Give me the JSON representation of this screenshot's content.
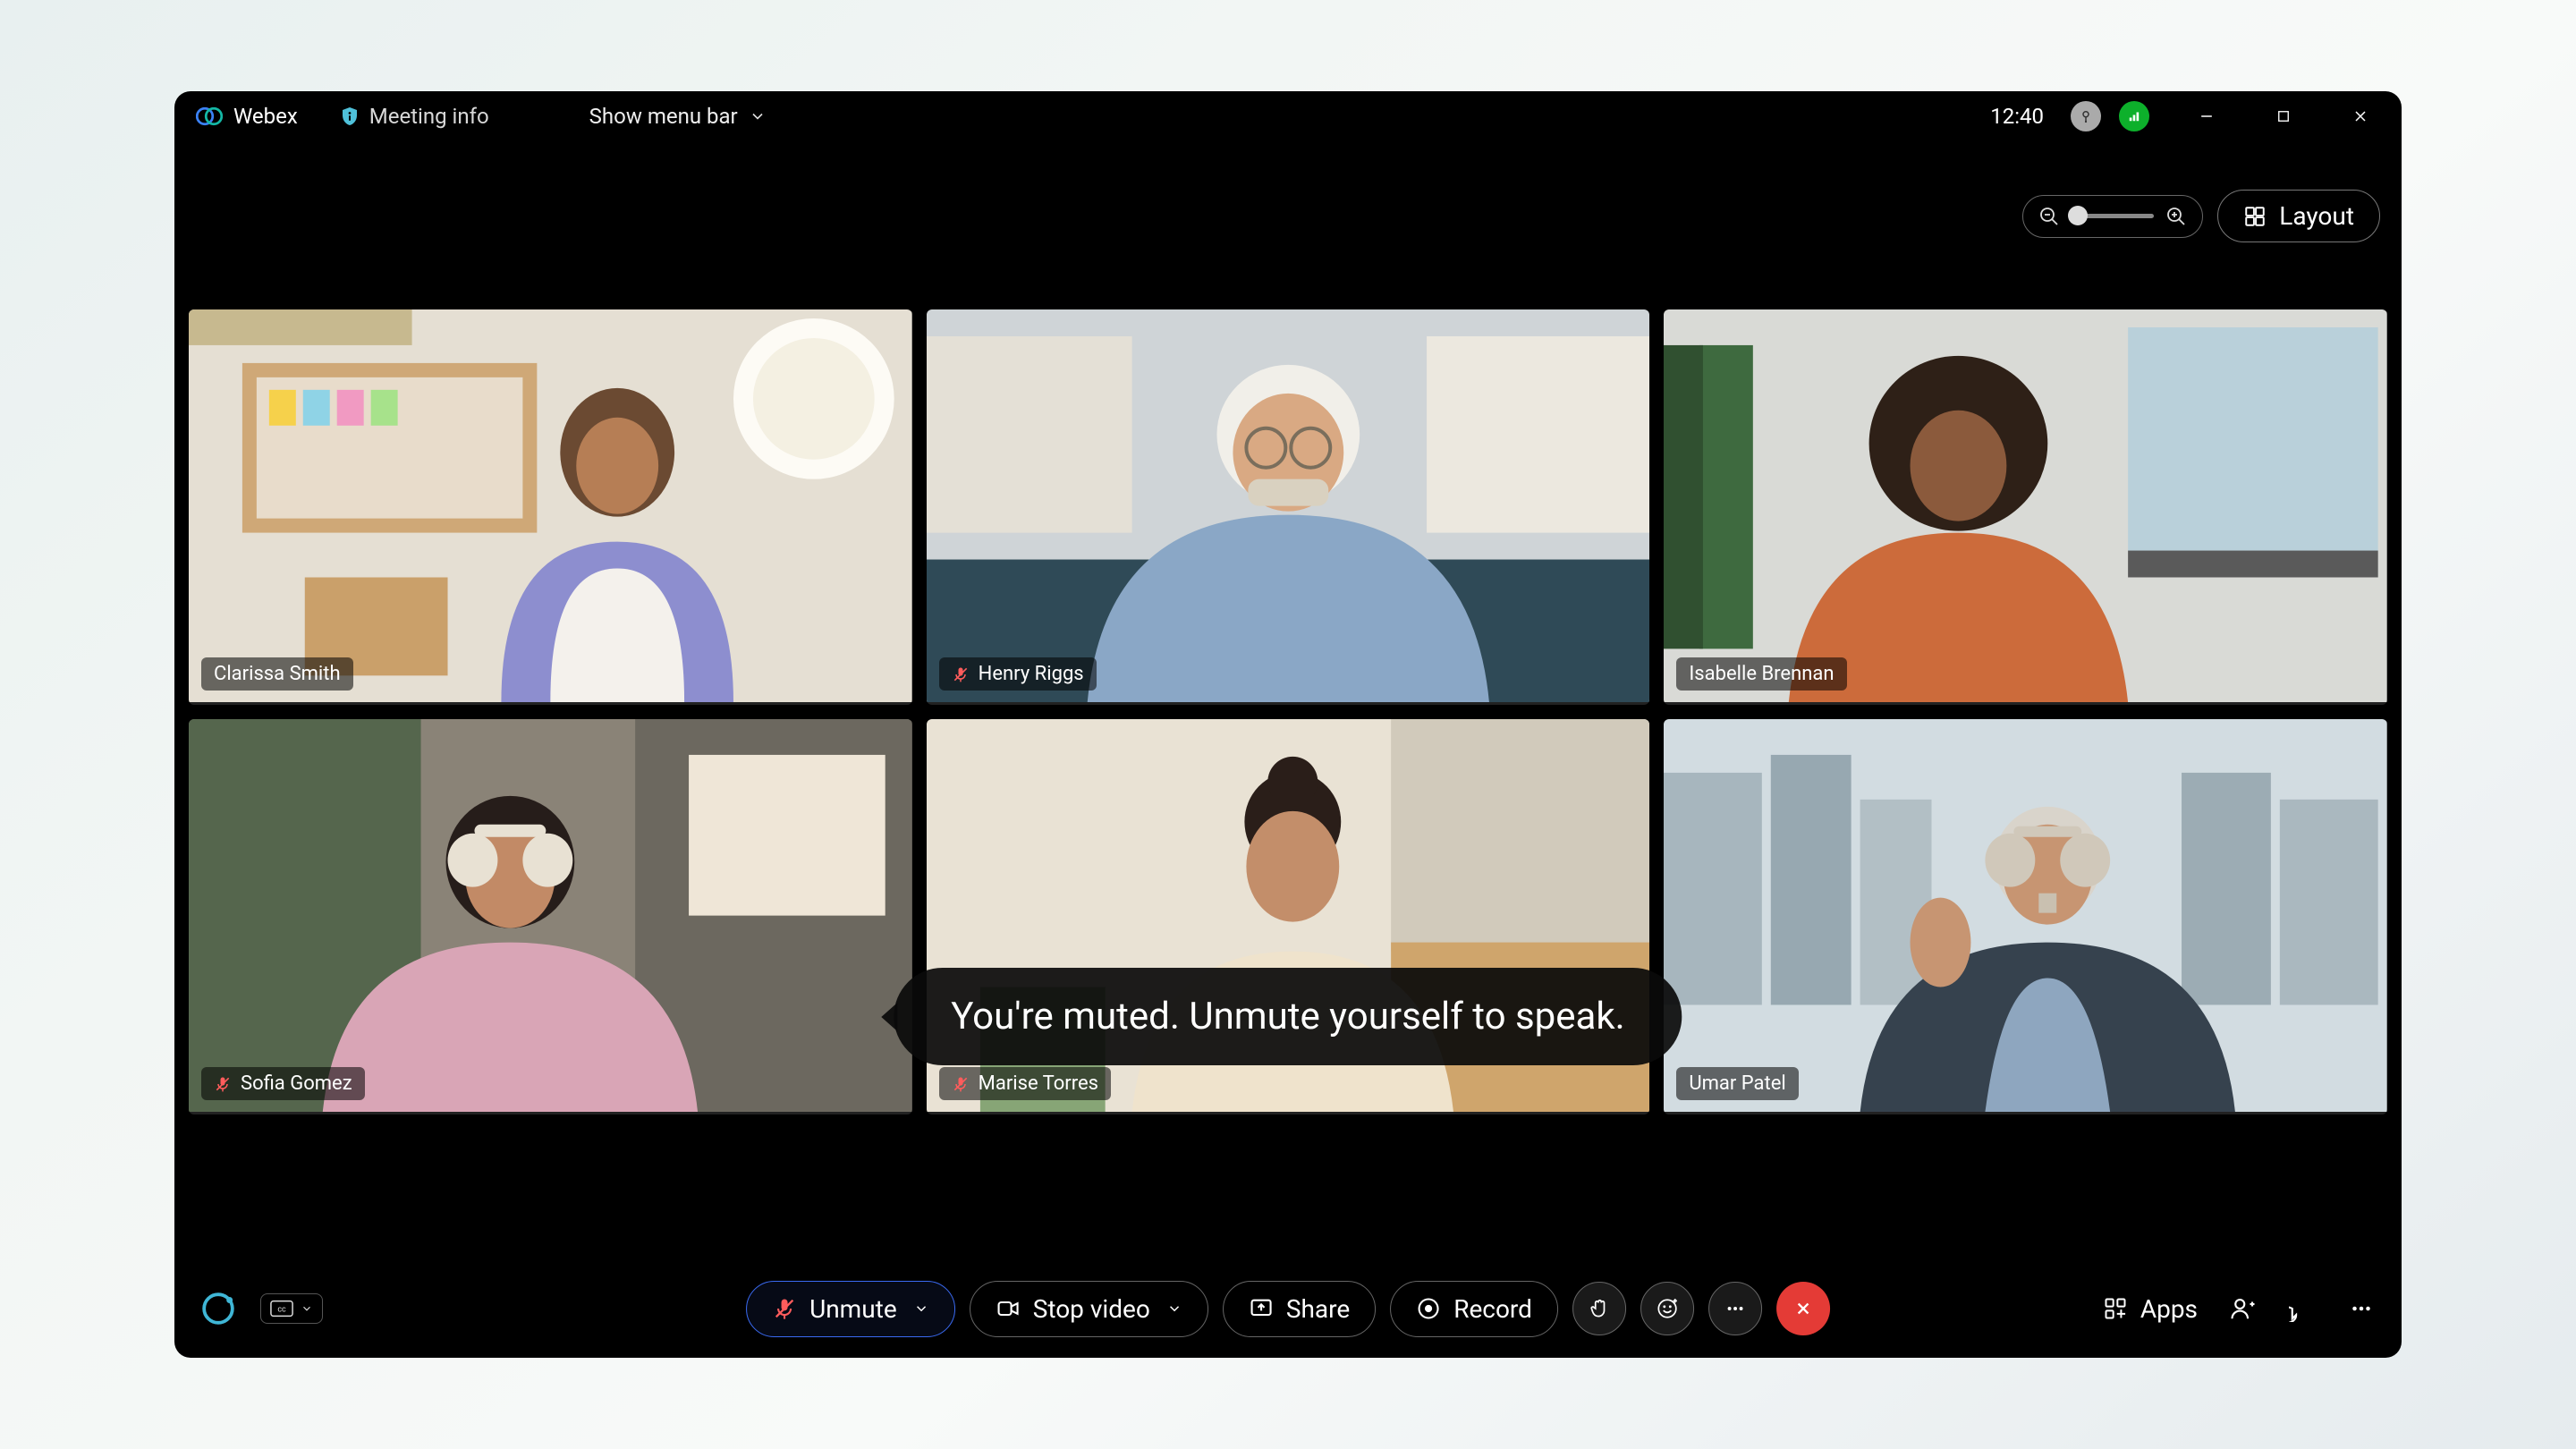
{
  "title_bar": {
    "app_name": "Webex",
    "meeting_info_label": "Meeting info",
    "show_menu_label": "Show menu bar",
    "clock": "12:40"
  },
  "layout_controls": {
    "layout_label": "Layout"
  },
  "participants": [
    {
      "name": "Clarissa Smith",
      "muted": false
    },
    {
      "name": "Henry Riggs",
      "muted": true
    },
    {
      "name": "Isabelle Brennan",
      "muted": false
    },
    {
      "name": "Sofia Gomez",
      "muted": true
    },
    {
      "name": "Marise Torres",
      "muted": true
    },
    {
      "name": "Umar Patel",
      "muted": false
    }
  ],
  "toast": {
    "message": "You're muted. Unmute yourself to speak."
  },
  "bottom_bar": {
    "unmute_label": "Unmute",
    "stop_video_label": "Stop video",
    "share_label": "Share",
    "record_label": "Record",
    "apps_label": "Apps"
  },
  "colors": {
    "accent_blue": "#3a6af2",
    "danger_red": "#e43b36",
    "muted_red": "#ff5c5c",
    "signal_green": "#0db02b"
  }
}
